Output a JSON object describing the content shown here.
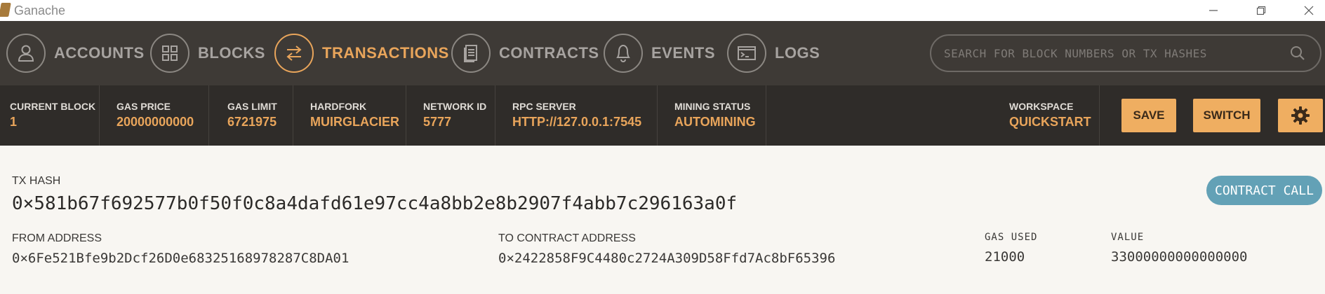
{
  "window": {
    "title": "Ganache"
  },
  "nav": {
    "items": [
      {
        "label": "ACCOUNTS",
        "icon": "user-icon"
      },
      {
        "label": "BLOCKS",
        "icon": "grid-icon"
      },
      {
        "label": "TRANSACTIONS",
        "icon": "swap-arrows-icon"
      },
      {
        "label": "CONTRACTS",
        "icon": "document-icon"
      },
      {
        "label": "EVENTS",
        "icon": "bell-icon"
      },
      {
        "label": "LOGS",
        "icon": "terminal-icon"
      }
    ],
    "active": "TRANSACTIONS",
    "search_placeholder": "SEARCH FOR BLOCK NUMBERS OR TX HASHES"
  },
  "status": {
    "current_block": {
      "label": "CURRENT BLOCK",
      "value": "1"
    },
    "gas_price": {
      "label": "GAS PRICE",
      "value": "20000000000"
    },
    "gas_limit": {
      "label": "GAS LIMIT",
      "value": "6721975"
    },
    "hardfork": {
      "label": "HARDFORK",
      "value": "MUIRGLACIER"
    },
    "network_id": {
      "label": "NETWORK ID",
      "value": "5777"
    },
    "rpc_server": {
      "label": "RPC SERVER",
      "value": "HTTP://127.0.0.1:7545"
    },
    "mining_status": {
      "label": "MINING STATUS",
      "value": "AUTOMINING"
    },
    "workspace": {
      "label": "WORKSPACE",
      "value": "QUICKSTART"
    },
    "save_label": "SAVE",
    "switch_label": "SWITCH"
  },
  "transaction": {
    "hash_label": "TX HASH",
    "hash": "0×581b67f692577b0f50f0c8a4dafd61e97cc4a8bb2e8b2907f4abb7c296163a0f",
    "type_badge": "CONTRACT CALL",
    "from_label": "FROM ADDRESS",
    "from": "0×6Fe521Bfe9b2Dcf26D0e68325168978287C8DA01",
    "to_label": "TO CONTRACT ADDRESS",
    "to": "0×2422858F9C4480c2724A309D58Ffd7Ac8bF65396",
    "gas_used_label": "GAS USED",
    "gas_used": "21000",
    "value_label": "VALUE",
    "value": "33000000000000000"
  },
  "colors": {
    "accent": "#e9a55b",
    "nav_bg": "#3e3a36",
    "status_bg": "#2f2c29",
    "badge": "#63a1b6"
  }
}
